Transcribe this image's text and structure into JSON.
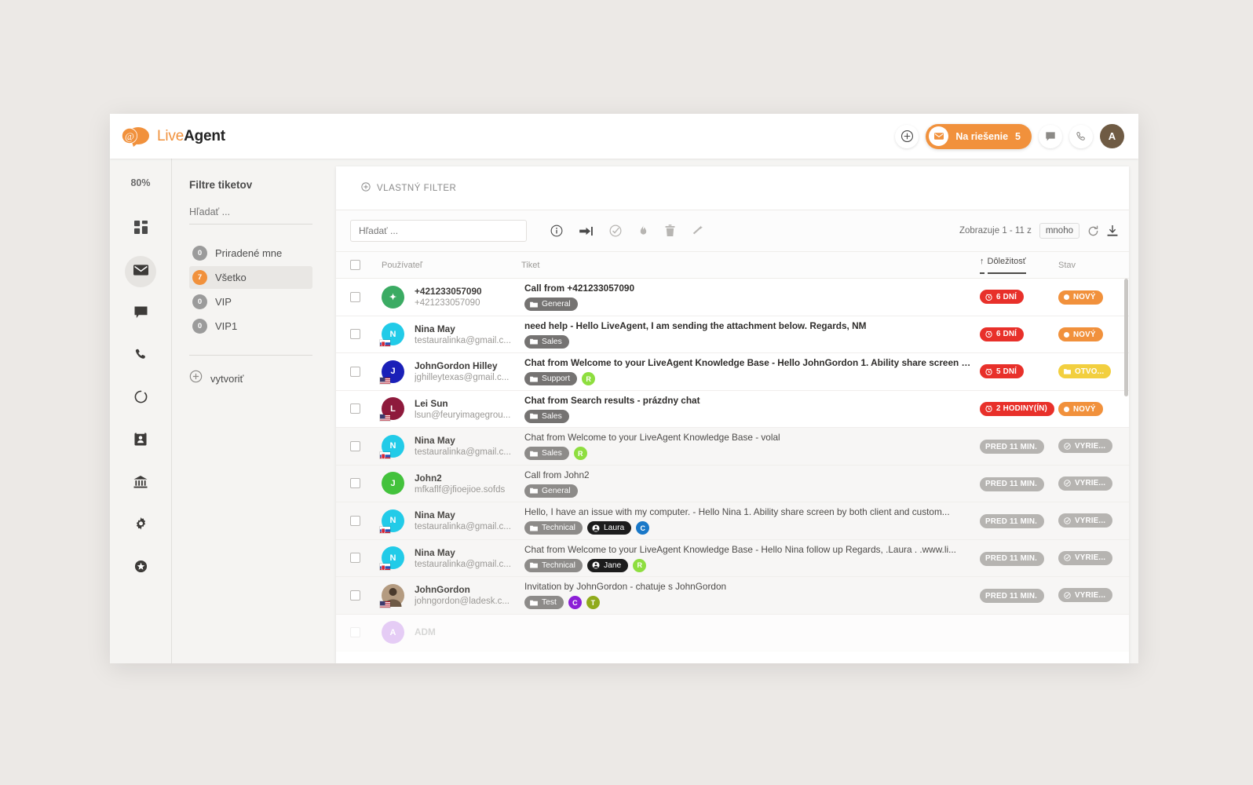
{
  "brand": {
    "name_light": "Live",
    "name_bold": "Agent"
  },
  "header": {
    "add_icon": "plus-circle-icon",
    "solve": {
      "label": "Na riešenie",
      "count": "5",
      "icon": "envelope-icon",
      "color": "#f1913c"
    },
    "chat_icon": "chat-bubble-icon",
    "call_icon": "phone-icon",
    "avatar_initial": "A",
    "avatar_color": "#6f5b44"
  },
  "rail": {
    "percent": "80%",
    "items": [
      {
        "name": "dashboard-icon",
        "active": false
      },
      {
        "name": "mail-icon",
        "active": true
      },
      {
        "name": "chat-icon",
        "active": false
      },
      {
        "name": "phone-icon",
        "active": false
      },
      {
        "name": "circle-progress-icon",
        "active": false
      },
      {
        "name": "contacts-icon",
        "active": false
      },
      {
        "name": "bank-icon",
        "active": false
      },
      {
        "name": "gear-icon",
        "active": false
      },
      {
        "name": "star-badge-icon",
        "active": false
      }
    ]
  },
  "filters": {
    "title": "Filtre tiketov",
    "search_placeholder": "Hľadať ...",
    "search_value": "",
    "items": [
      {
        "count": "0",
        "label": "Priradené mne",
        "selected": false
      },
      {
        "count": "7",
        "label": "Všetko",
        "selected": true
      },
      {
        "count": "0",
        "label": "VIP",
        "selected": false
      },
      {
        "count": "0",
        "label": "VIP1",
        "selected": false
      }
    ],
    "create_label": "vytvoriť"
  },
  "tabs": {
    "custom_filter": "VLASTNÝ FILTER"
  },
  "toolbar": {
    "search_placeholder": "Hľadať ...",
    "search_value": "",
    "icons": [
      "info-circle-icon",
      "forward-arrow-icon",
      "check-circle-icon",
      "fire-icon",
      "trash-icon",
      "wand-icon"
    ],
    "showing_text": "Zobrazuje 1 - 11 z",
    "many_label": "mnoho",
    "refresh_icon": "refresh-icon",
    "download_icon": "download-icon"
  },
  "table": {
    "columns": {
      "user": "Používateľ",
      "ticket": "Tiket",
      "priority": "Dôležitosť",
      "state": "Stav",
      "sort_arrow": "↑"
    },
    "rows": [
      {
        "avatar_initial": "✦",
        "avatar_color": "#3bab63",
        "flag": null,
        "photo": false,
        "name": "+421233057090",
        "email": "+421233057090",
        "subject": "Call from +421233057090",
        "unread": true,
        "tags": [
          {
            "type": "folder",
            "label": "General"
          }
        ],
        "priority": {
          "label": "6 DNÍ",
          "color": "#e8302a",
          "icon": "clock-icon"
        },
        "state": {
          "label": "NOVÝ",
          "color": "#f1913c",
          "icon": "dot-icon"
        },
        "read": false
      },
      {
        "avatar_initial": "N",
        "avatar_color": "#22cbe8",
        "flag": "sk",
        "photo": false,
        "name": "Nina May",
        "email": "testauralinka@gmail.c...",
        "subject": "need help - Hello LiveAgent, I am sending the attachment below. Regards, NM",
        "unread": true,
        "tags": [
          {
            "type": "folder",
            "label": "Sales"
          }
        ],
        "priority": {
          "label": "6 DNÍ",
          "color": "#e8302a",
          "icon": "clock-icon"
        },
        "state": {
          "label": "NOVÝ",
          "color": "#f1913c",
          "icon": "dot-icon"
        },
        "read": false
      },
      {
        "avatar_initial": "J",
        "avatar_color": "#1a20b8",
        "flag": "us",
        "photo": false,
        "name": "JohnGordon Hilley",
        "email": "jghilleytexas@gmail.c...",
        "subject": "Chat from Welcome to your LiveAgent Knowledge Base - Hello JohnGordon 1. Ability share screen b...",
        "unread": true,
        "tags": [
          {
            "type": "folder",
            "label": "Support"
          },
          {
            "type": "dot",
            "label": "R",
            "color": "#8ede3f"
          }
        ],
        "priority": {
          "label": "5 DNÍ",
          "color": "#e8302a",
          "icon": "clock-icon"
        },
        "state": {
          "label": "OTVO...",
          "color": "#f2cf3f",
          "icon": "folder-icon"
        },
        "read": false
      },
      {
        "avatar_initial": "L",
        "avatar_color": "#8e1a3c",
        "flag": "us",
        "photo": false,
        "name": "Lei Sun",
        "email": "lsun@feuryimagegrou...",
        "subject": "Chat from Search results - prázdny chat",
        "unread": true,
        "tags": [
          {
            "type": "folder",
            "label": "Sales"
          }
        ],
        "priority": {
          "label": "2 HODINY(ÍN)",
          "color": "#e8302a",
          "icon": "clock-icon"
        },
        "state": {
          "label": "NOVÝ",
          "color": "#f1913c",
          "icon": "dot-icon"
        },
        "read": false
      },
      {
        "avatar_initial": "N",
        "avatar_color": "#22cbe8",
        "flag": "sk",
        "photo": false,
        "name": "Nina May",
        "email": "testauralinka@gmail.c...",
        "subject": "Chat from Welcome to your LiveAgent Knowledge Base - volal",
        "unread": false,
        "tags": [
          {
            "type": "folder",
            "label": "Sales"
          },
          {
            "type": "dot",
            "label": "R",
            "color": "#8ede3f"
          }
        ],
        "priority": {
          "label": "PRED 11 MIN.",
          "color": "#b6b4b1",
          "icon": null
        },
        "state": {
          "label": "VYRIE...",
          "color": "#b6b4b1",
          "icon": "check-circle-icon"
        },
        "read": true
      },
      {
        "avatar_initial": "J",
        "avatar_color": "#43c23c",
        "flag": null,
        "photo": false,
        "name": "John2",
        "email": "mfkaflf@jfioejioe.sofds",
        "subject": "Call from John2",
        "unread": false,
        "tags": [
          {
            "type": "folder",
            "label": "General"
          }
        ],
        "priority": {
          "label": "PRED 11 MIN.",
          "color": "#b6b4b1",
          "icon": null
        },
        "state": {
          "label": "VYRIE...",
          "color": "#b6b4b1",
          "icon": "check-circle-icon"
        },
        "read": true
      },
      {
        "avatar_initial": "N",
        "avatar_color": "#22cbe8",
        "flag": "sk",
        "photo": false,
        "name": "Nina May",
        "email": "testauralinka@gmail.c...",
        "subject": "Hello, I have an issue with my computer. - Hello Nina 1. Ability share screen by both client and custom...",
        "unread": false,
        "tags": [
          {
            "type": "folder",
            "label": "Technical"
          },
          {
            "type": "agent",
            "label": "Laura"
          },
          {
            "type": "dot",
            "label": "C",
            "color": "#1978c8"
          }
        ],
        "priority": {
          "label": "PRED 11 MIN.",
          "color": "#b6b4b1",
          "icon": null
        },
        "state": {
          "label": "VYRIE...",
          "color": "#b6b4b1",
          "icon": "check-circle-icon"
        },
        "read": true
      },
      {
        "avatar_initial": "N",
        "avatar_color": "#22cbe8",
        "flag": "sk",
        "photo": false,
        "name": "Nina May",
        "email": "testauralinka@gmail.c...",
        "subject": "Chat from Welcome to your LiveAgent Knowledge Base - Hello Nina follow up Regards, .Laura . .www.li...",
        "unread": false,
        "tags": [
          {
            "type": "folder",
            "label": "Technical"
          },
          {
            "type": "agent",
            "label": "Jane"
          },
          {
            "type": "dot",
            "label": "R",
            "color": "#8ede3f"
          }
        ],
        "priority": {
          "label": "PRED 11 MIN.",
          "color": "#b6b4b1",
          "icon": null
        },
        "state": {
          "label": "VYRIE...",
          "color": "#b6b4b1",
          "icon": "check-circle-icon"
        },
        "read": true
      },
      {
        "avatar_initial": "",
        "avatar_color": "#8a7b6b",
        "flag": "us",
        "photo": true,
        "name": "JohnGordon",
        "email": "johngordon@ladesk.c...",
        "subject": "Invitation by JohnGordon - chatuje s JohnGordon",
        "unread": false,
        "tags": [
          {
            "type": "folder",
            "label": "Test"
          },
          {
            "type": "dot",
            "label": "C",
            "color": "#8b1ed6"
          },
          {
            "type": "dot",
            "label": "T",
            "color": "#90ab1b"
          }
        ],
        "priority": {
          "label": "PRED 11 MIN.",
          "color": "#b6b4b1",
          "icon": null
        },
        "state": {
          "label": "VYRIE...",
          "color": "#b6b4b1",
          "icon": "check-circle-icon"
        },
        "read": true
      },
      {
        "avatar_initial": "A",
        "avatar_color": "#8b1ed6",
        "flag": null,
        "photo": false,
        "name": "ADM",
        "email": "",
        "subject": "",
        "unread": false,
        "tags": [],
        "priority": {
          "label": "",
          "color": "#b6b4b1",
          "icon": null
        },
        "state": {
          "label": "",
          "color": "#b6b4b1",
          "icon": null
        },
        "read": true
      }
    ]
  }
}
